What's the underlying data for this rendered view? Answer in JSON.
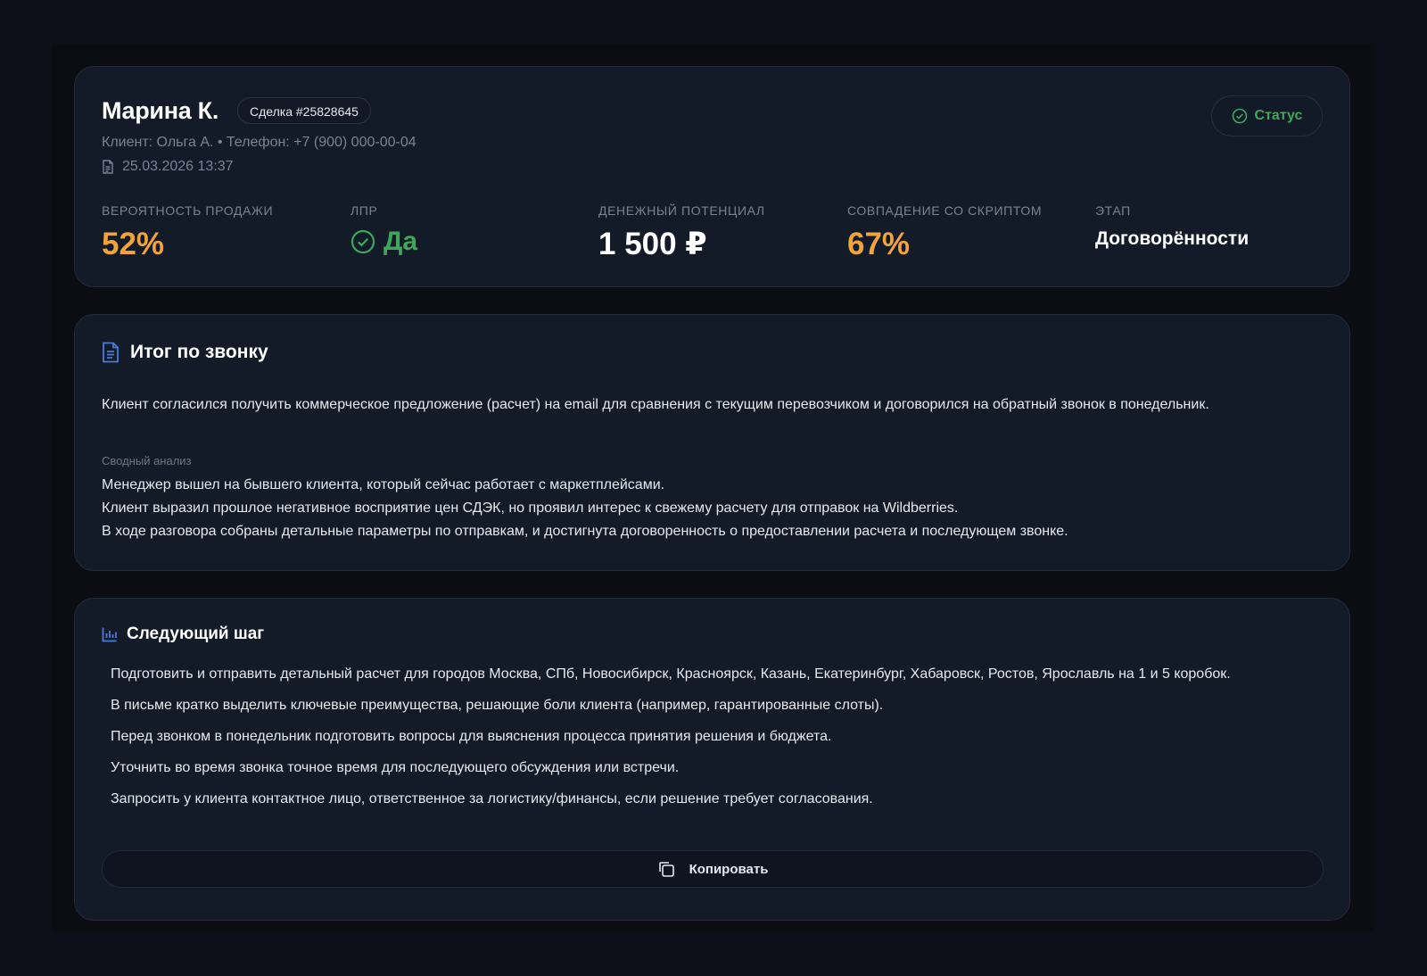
{
  "header": {
    "name": "Марина К.",
    "deal_badge": "Сделка #25828645",
    "client_line": "Клиент: Ольга А. • Телефон: +7 (900) 000-00-04",
    "date": "25.03.2026 13:37",
    "status_label": "Статус",
    "metrics": {
      "probability": {
        "label": "Вероятность продажи",
        "value": "52%"
      },
      "lpr": {
        "label": "ЛПР",
        "value": "Да"
      },
      "money": {
        "label": "Денежный потенциал",
        "value": "1 500 ₽"
      },
      "script": {
        "label": "Совпадение со скриптом",
        "value": "67%"
      },
      "stage": {
        "label": "Этап",
        "value": "Договорённости"
      }
    }
  },
  "summary": {
    "title": "Итог по звонку",
    "text": "Клиент согласился получить коммерческое предложение (расчет) на email для сравнения с текущим перевозчиком и договорился на обратный звонок в понедельник.",
    "analysis_label": "Сводный анализ",
    "analysis": [
      "Менеджер вышел на бывшего клиента, который сейчас работает с маркетплейсами.",
      "Клиент выразил прошлое негативное восприятие цен СДЭК, но проявил интерес к свежему расчету для отправок на Wildberries.",
      "В ходе разговора собраны детальные параметры по отправкам, и достигнута договоренность о предоставлении расчета и последующем звонке."
    ]
  },
  "next_step": {
    "title": "Следующий шаг",
    "items": [
      "Подготовить и отправить детальный расчет для городов Москва, СПб, Новосибирск, Красноярск, Казань, Екатеринбург, Хабаровск, Ростов, Ярославль на 1 и 5 коробок.",
      "В письме кратко выделить ключевые преимущества, решающие боли клиента (например, гарантированные слоты).",
      "Перед звонком в понедельник подготовить вопросы для выяснения процесса принятия решения и бюджета.",
      "Уточнить во время звонка точное время для последующего обсуждения или встречи.",
      "Запросить у клиента контактное лицо, ответственное за логистику/финансы, если решение требует согласования."
    ],
    "copy_label": "Копировать"
  },
  "icons": {
    "date": "document-icon",
    "status": "check-circle-icon",
    "lpr": "check-circle-icon",
    "summary": "document-icon",
    "next_step": "bar-chart-icon",
    "copy": "copy-icon"
  },
  "colors": {
    "accent_orange": "#f0a43a",
    "accent_green": "#3fa65b",
    "accent_blue": "#4b7bd8",
    "card_bg": "#131a28"
  }
}
